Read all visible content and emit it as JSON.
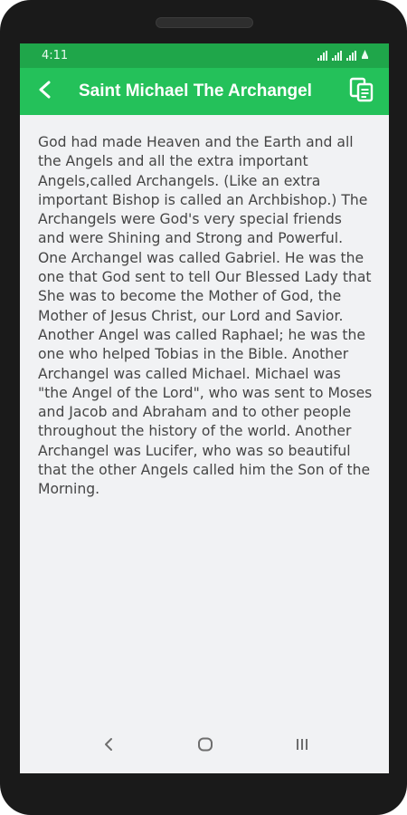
{
  "status": {
    "time": "4:11",
    "icons": [
      "signal-icon",
      "signal-icon",
      "signal-icon",
      "battery-saver-icon"
    ]
  },
  "toolbar": {
    "title": "Saint Michael The Archangel",
    "back_icon": "back-arrow-icon",
    "copy_icon": "copy-icon"
  },
  "content": {
    "body": "God had made Heaven and the Earth and all the Angels and all the extra important Angels,called Archangels. (Like an extra important Bishop is called an Archbishop.) The Archangels were God's very special friends and were Shining and Strong and Powerful. One Archangel was called Gabriel. He was the one that God sent to tell Our Blessed Lady that She was to become the Mother of God, the Mother of Jesus Christ, our Lord and Savior. Another Angel was called Raphael; he was the one who helped Tobias in the Bible. Another Archangel was called Michael. Michael was \"the Angel of the Lord\", who was sent to Moses and Jacob and Abraham and to other people throughout the history of the world. Another Archangel was Lucifer, who was so beautiful that the other Angels called him the Son of the Morning."
  },
  "navbar": {
    "back": "nav-back-icon",
    "home": "nav-home-icon",
    "recents": "nav-recents-icon"
  },
  "colors": {
    "statusbar": "#1fa64a",
    "toolbar": "#24c15a",
    "background": "#f1f2f4",
    "text": "#454545"
  }
}
